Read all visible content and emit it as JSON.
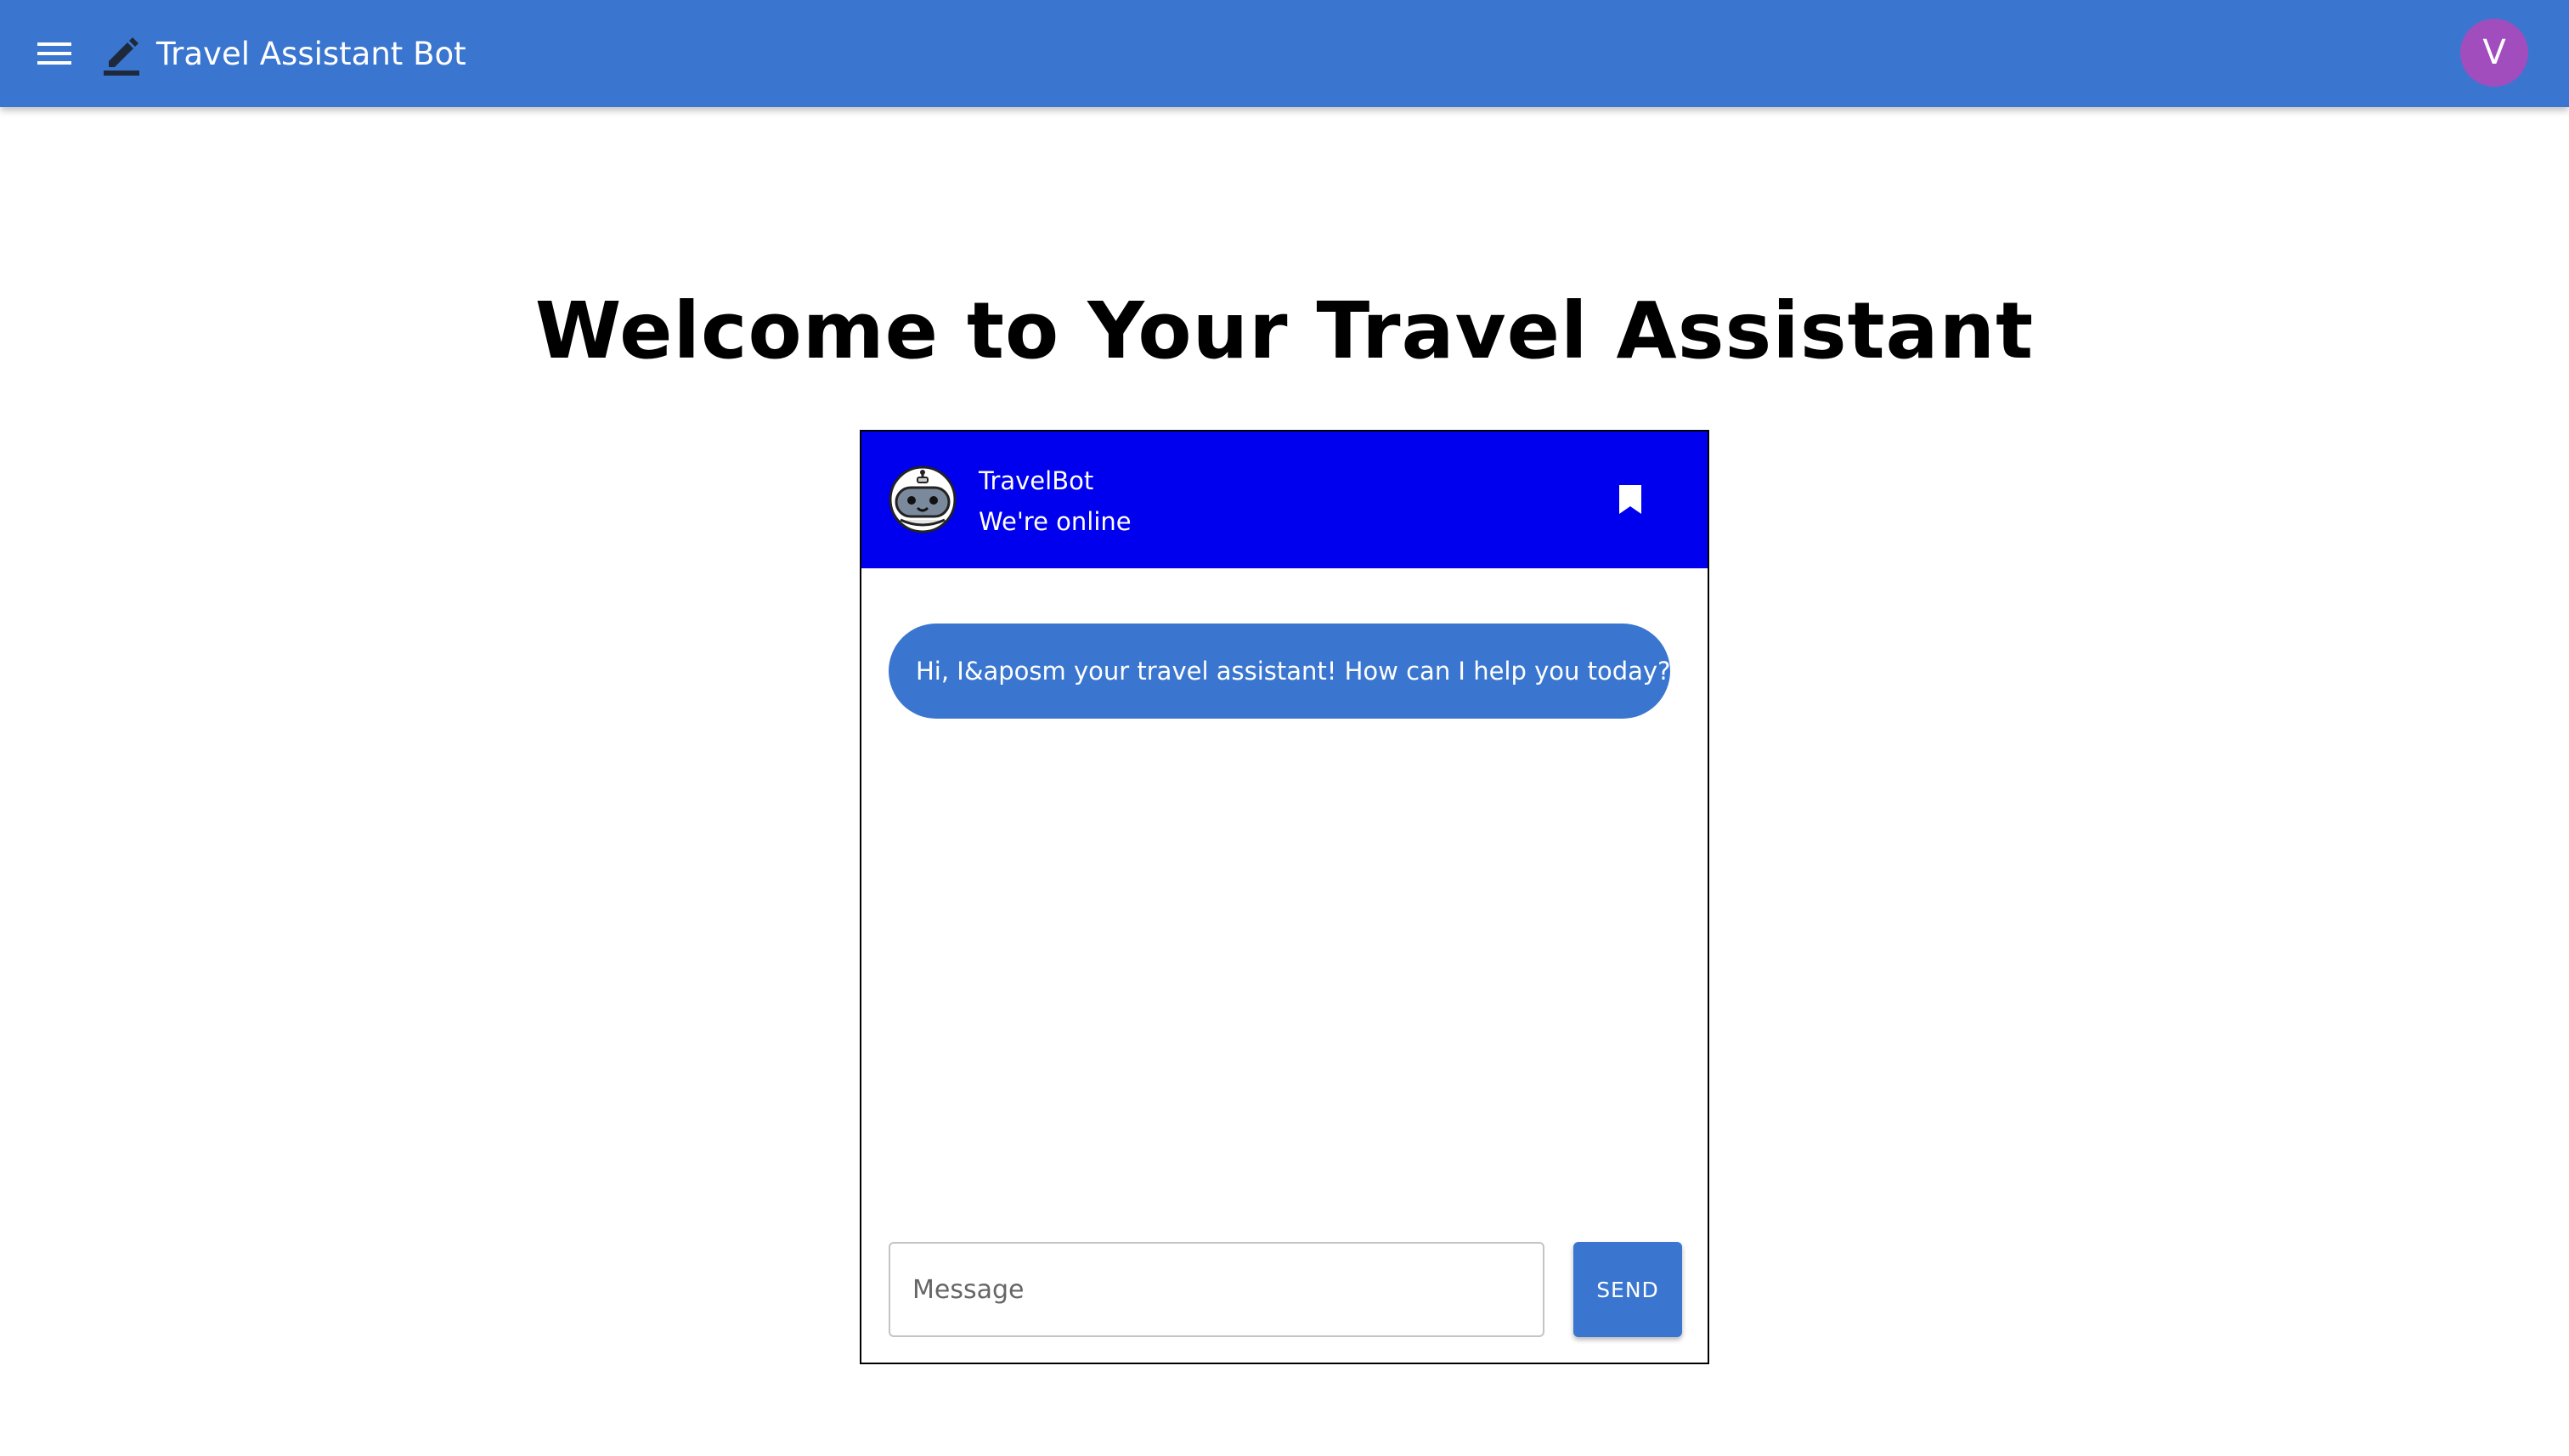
{
  "appbar": {
    "title": "Travel Assistant Bot",
    "menu_icon": "menu-icon",
    "logo_icon": "edit-icon",
    "avatar_letter": "V",
    "color": "#3a76cf",
    "avatar_color": "#a14dbd"
  },
  "main": {
    "heading": "Welcome to Your Travel Assistant"
  },
  "chat": {
    "header_color": "#0000ee",
    "bot_name": "TravelBot",
    "status": "We're online",
    "bot_avatar_icon": "robot-icon",
    "bookmark_icon": "bookmark-icon",
    "messages": [
      {
        "sender": "bot",
        "text": "Hi, I&aposm your travel assistant! How can I help you today?"
      }
    ],
    "input_placeholder": "Message",
    "input_value": "",
    "send_label": "SEND"
  }
}
